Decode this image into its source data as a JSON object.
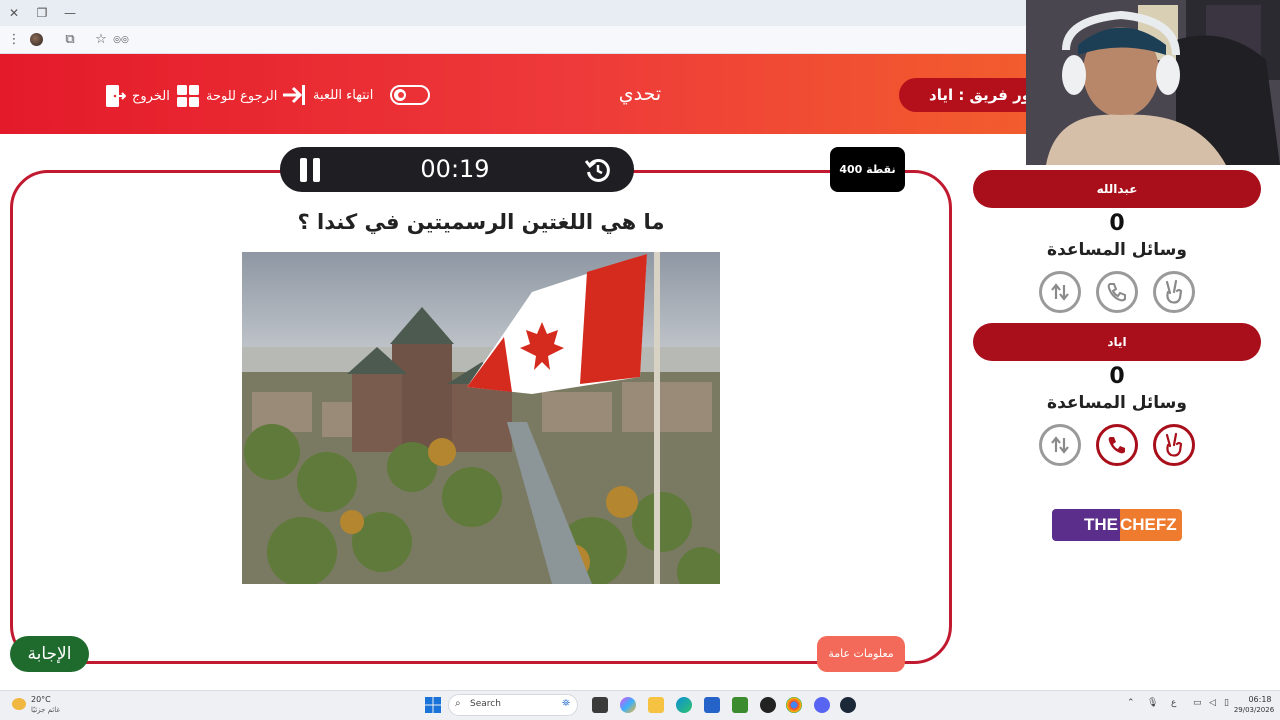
{
  "browser": {
    "close_glyph": "✕",
    "restore_glyph": "❐",
    "minimize_glyph": "—",
    "menu_glyph": "⋮",
    "extensions_glyph": "⧉",
    "bookmark_glyph": "☆",
    "incognito_glyph": "◎◎"
  },
  "header": {
    "title": "تحدي",
    "exit_label": "الخروج",
    "back_to_board_label": "الرجوع للوحة",
    "end_game_label": "انتهاء اللعبة",
    "team_turn_label": "دور فريق : اياد",
    "end_game_toggle_on": false
  },
  "question": {
    "timer": "00:19",
    "points": "400 نقطة",
    "text": "ما هي اللغتين الرسميتين في كندا ؟",
    "category": "معلومات عامة",
    "answer_label": "الإجابة"
  },
  "teams": [
    {
      "name": "عبدالله",
      "score": "0",
      "aids_label": "وسائل المساعدة",
      "aids": [
        {
          "icon": "hand-peace-icon",
          "active": false
        },
        {
          "icon": "phone-icon",
          "active": false
        },
        {
          "icon": "swap-arrows-icon",
          "active": false
        }
      ]
    },
    {
      "name": "اياد",
      "score": "0",
      "aids_label": "وسائل المساعدة",
      "aids": [
        {
          "icon": "hand-peace-icon",
          "active": true
        },
        {
          "icon": "phone-icon",
          "active": true
        },
        {
          "icon": "swap-arrows-icon",
          "active": false
        }
      ]
    }
  ],
  "brand": {
    "part1": "THE",
    "part2": "CHEFZ"
  },
  "taskbar": {
    "weather_temp": "20°C",
    "weather_condition": "غائم جزئيًا",
    "search_label": "Search",
    "tray_lang": "ع",
    "time": "06:18",
    "date": "29/03/2026"
  },
  "colors": {
    "header_gradient_start": "#e41a2a",
    "header_gradient_end": "#f46a2c",
    "team_pill": "#a80f1b",
    "answer_button": "#1f6b2e",
    "frame_border": "#c11a30"
  }
}
